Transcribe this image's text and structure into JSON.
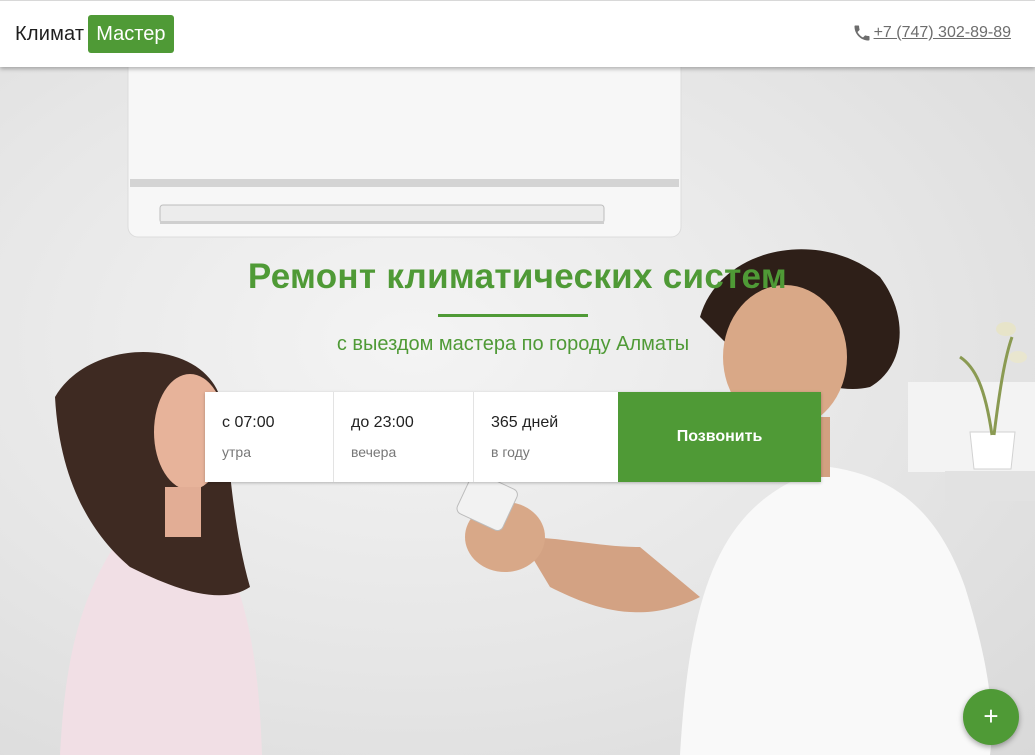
{
  "header": {
    "logo_text": "Климат",
    "logo_badge": "Мастер",
    "phone": "+7 (747) 302-89-89",
    "icon": "phone-icon"
  },
  "hero": {
    "title": "Ремонт климатических систем",
    "subtitle": "с выездом мастера по городу Алматы",
    "hours": [
      {
        "value": "с 07:00",
        "label": "утра"
      },
      {
        "value": "до 23:00",
        "label": "вечера"
      },
      {
        "value": "365 дней",
        "label": "в году"
      }
    ],
    "call_button": "Позвонить"
  },
  "fab": {
    "label": "+",
    "icon": "plus-icon"
  },
  "colors": {
    "accent": "#4f9a36",
    "header_bg": "#ffffff",
    "text_dark": "#1e1e1e"
  }
}
